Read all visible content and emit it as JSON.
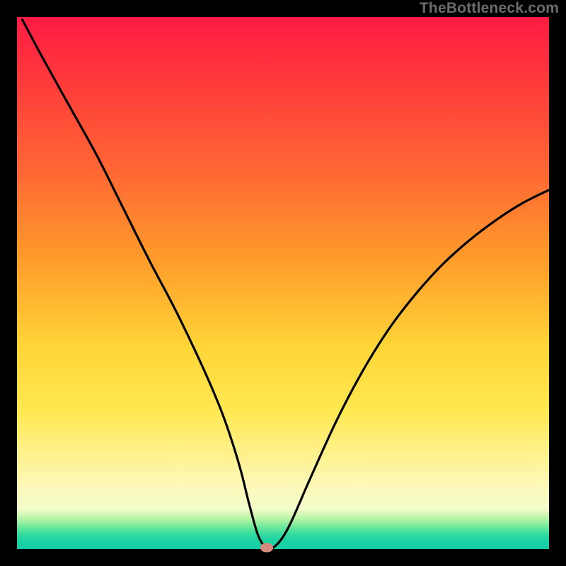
{
  "watermark": "TheBottleneck.com",
  "chart_data": {
    "type": "line",
    "title": "",
    "xlabel": "",
    "ylabel": "",
    "xlim": [
      0,
      100
    ],
    "ylim": [
      0,
      100
    ],
    "x": [
      1,
      5,
      10,
      15,
      20,
      25,
      30,
      35,
      38,
      40,
      42,
      43.5,
      45,
      46,
      47,
      48.5,
      51,
      55,
      60,
      65,
      70,
      75,
      80,
      85,
      90,
      95,
      100
    ],
    "values": [
      99.5,
      92,
      83,
      74,
      64,
      54,
      44.5,
      34,
      27,
      21.5,
      15,
      9,
      3.5,
      1.2,
      0.4,
      0.5,
      4,
      13,
      24,
      33.5,
      41.5,
      48,
      53.5,
      58,
      61.8,
      65,
      67.5
    ],
    "min_point": {
      "x": 47,
      "y": 0.2
    },
    "grid": false,
    "legend": false
  },
  "marker": {
    "x_pct": 47,
    "y_pct": 0.2
  }
}
